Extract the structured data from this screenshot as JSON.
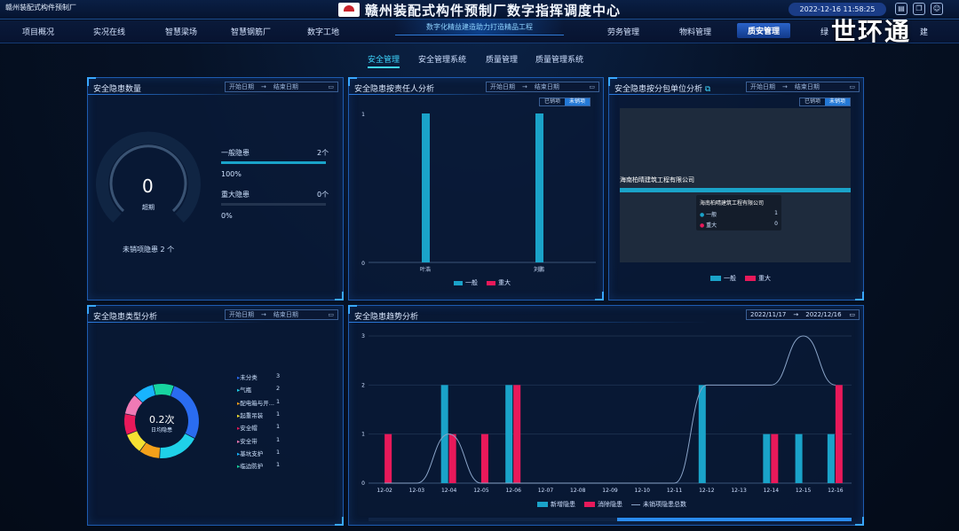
{
  "topbar": {
    "company": "赣州装配式构件预制厂",
    "title": "赣州装配式构件预制厂数字指挥调度中心",
    "datetime": "2022-12-16 11:58:25",
    "brand": "世环通"
  },
  "nav": {
    "left": [
      "项目概况",
      "实况在线",
      "智慧梁场",
      "智慧钢筋厂",
      "数字工地"
    ],
    "right": [
      "劳务管理",
      "物料管理",
      "质安管理",
      "绿"
    ],
    "active": "质安管理",
    "slogan": "数字化精益建造助力打造精品工程",
    "partial_right": "建"
  },
  "subnav": [
    "安全管理",
    "安全管理系统",
    "质量管理",
    "质量管理系统"
  ],
  "common": {
    "start": "开始日期",
    "end": "结束日期",
    "arrow": "→",
    "unrectified": "未销项",
    "rectified": "已销项"
  },
  "panel1": {
    "title": "安全隐患数量",
    "gauge_value": "0",
    "gauge_label": "超期",
    "general_label": "一般隐患",
    "general_count": "2个",
    "general_pct": "100%",
    "general_fill": 1.0,
    "major_label": "重大隐患",
    "major_count": "0个",
    "major_pct": "0%",
    "major_fill": 0,
    "pending": "未销项隐患 2 个"
  },
  "panel2": {
    "title": "安全隐患按责任人分析",
    "y_top": "1",
    "y_bottom": "0",
    "legend": [
      "一般",
      "重大"
    ],
    "chart_data": {
      "type": "bar",
      "categories": [
        "叶浩",
        "刘鹏"
      ],
      "series": [
        {
          "name": "一般",
          "values": [
            1,
            1
          ]
        },
        {
          "name": "重大",
          "values": [
            0,
            0
          ]
        }
      ],
      "ylim": [
        0,
        1
      ]
    }
  },
  "panel3": {
    "title": "安全隐患按分包单位分析",
    "company": "海南柏晴建筑工程有限公司",
    "tooltip_title": "海南柏晴建筑工程有限公司",
    "tooltip_rows": [
      {
        "label": "一般",
        "value": "1"
      },
      {
        "label": "重大",
        "value": "0"
      }
    ],
    "legend": [
      "一般",
      "重大"
    ]
  },
  "panel4": {
    "title": "安全隐患类型分析",
    "center_value": "0.2次",
    "center_label": "日均隐患",
    "chart_data": {
      "type": "pie",
      "categories": [
        "未分类",
        "气瓶",
        "配电箱与开...",
        "起重吊装",
        "安全帽",
        "安全带",
        "基坑支护",
        "临边防护"
      ],
      "values": [
        3,
        2,
        1,
        1,
        1,
        1,
        1,
        1
      ]
    }
  },
  "panel5": {
    "title": "安全隐患趋势分析",
    "date_start": "2022/11/17",
    "date_end": "2022/12/16",
    "legend": [
      "新增隐患",
      "消除隐患",
      "未销项隐患总数"
    ],
    "chart_data": {
      "type": "bar",
      "categories": [
        "12-02",
        "12-03",
        "12-04",
        "12-05",
        "12-06",
        "12-07",
        "12-08",
        "12-09",
        "12-10",
        "12-11",
        "12-12",
        "12-13",
        "12-14",
        "12-15",
        "12-16"
      ],
      "series": [
        {
          "name": "新增隐患",
          "values": [
            0,
            0,
            2,
            0,
            2,
            0,
            0,
            0,
            0,
            0,
            2,
            0,
            1,
            1,
            1
          ]
        },
        {
          "name": "消除隐患",
          "values": [
            1,
            0,
            1,
            1,
            2,
            0,
            0,
            0,
            0,
            0,
            0,
            0,
            1,
            0,
            2
          ]
        },
        {
          "name": "未销项隐患总数",
          "values": [
            0,
            0,
            1,
            0,
            0,
            0,
            0,
            0,
            0,
            0,
            2,
            2,
            2,
            3,
            2
          ]
        }
      ],
      "ylim": [
        0,
        3
      ],
      "yticks": [
        "0",
        "1",
        "2",
        "3"
      ]
    }
  },
  "colors": {
    "general": "#1aa3c9",
    "major": "#e8195a",
    "accent": "#3fd6ff",
    "line": "#8aa4c8"
  }
}
